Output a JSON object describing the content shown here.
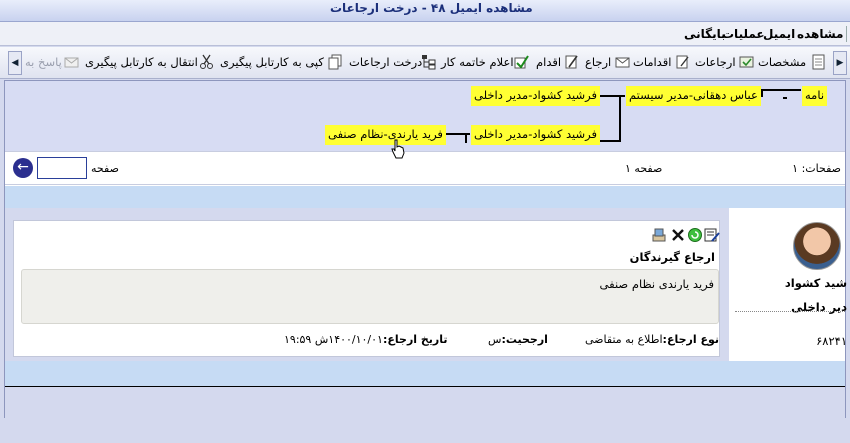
{
  "window": {
    "title": "مشاهده ایمیل  ۴۸  - درخت ارجاعات"
  },
  "menubar": {
    "items": [
      "مشاهده",
      "ایمیل",
      "عملیات",
      "بایگانی"
    ]
  },
  "toolbar": {
    "items": [
      {
        "label": "مشخصات",
        "icon": "document-icon"
      },
      {
        "label": "ارجاعات",
        "icon": "referrals-icon"
      },
      {
        "label": "اقدامات",
        "icon": "actions-icon"
      },
      {
        "label": "ارجاع",
        "icon": "refer-icon"
      },
      {
        "label": "اقدام",
        "icon": "pen-icon"
      },
      {
        "label": "اعلام خاتمه کار",
        "icon": "check-icon"
      },
      {
        "label": "درخت ارجاعات",
        "icon": "tree-icon"
      },
      {
        "label": "کپی به کارتابل پیگیری",
        "icon": "copy-icon"
      },
      {
        "label": "انتقال به کارتابل پیگیری",
        "icon": "scissors-icon"
      },
      {
        "label": "پاسخ به",
        "icon": "reply-icon",
        "disabled": true
      }
    ]
  },
  "tree": {
    "root": "نامه",
    "level1": "عباس دهقانی-مدیر سیستم",
    "level2": "فرشید کشواد-مدیر داخلی",
    "level2b": "فرشید کشواد-مدیر داخلی",
    "level3": "فرید یارندی-نظام صنفی"
  },
  "pager": {
    "pages_label": "صفحات: ۱",
    "current_page": "صفحه ۱",
    "goto_label": "صفحه",
    "goto_value": ""
  },
  "referral": {
    "heading": "ارجاع گیرندگان",
    "body": "فرید یارندی نظام صنفی",
    "type_label": "نوع ارجاع:",
    "type_value": "اطلاع به متقاضی",
    "priority_label": "ارجحیت:",
    "priority_value": "س",
    "date_label": "تاریخ ارجاع:",
    "date_value": "۱۴۰۰/۱۰/۰۱ش ۱۹:۵۹"
  },
  "sender": {
    "name": "شید کشواد",
    "role": "دیر داخلی",
    "code": "۶۸۲۴۱"
  },
  "colors": {
    "node_bg": "#ffff33",
    "tree_bg": "#d7dcf3",
    "band": "#c6dbf4"
  }
}
